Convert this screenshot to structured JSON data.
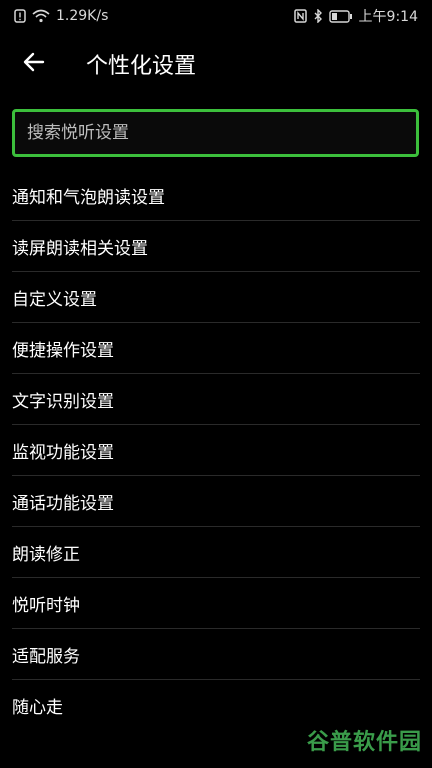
{
  "status_bar": {
    "network_speed": "1.29K/s",
    "time": "上午9:14",
    "icons": [
      "notification-icon",
      "wifi-icon",
      "nfc-icon",
      "bluetooth-icon",
      "battery-icon"
    ]
  },
  "header": {
    "title": "个性化设置"
  },
  "search": {
    "placeholder": "搜索悦听设置"
  },
  "menu": {
    "items": [
      {
        "label": "通知和气泡朗读设置"
      },
      {
        "label": "读屏朗读相关设置"
      },
      {
        "label": "自定义设置"
      },
      {
        "label": "便捷操作设置"
      },
      {
        "label": "文字识别设置"
      },
      {
        "label": "监视功能设置"
      },
      {
        "label": "通话功能设置"
      },
      {
        "label": "朗读修正"
      },
      {
        "label": "悦听时钟"
      },
      {
        "label": "适配服务"
      },
      {
        "label": "随心走"
      }
    ]
  },
  "watermark": {
    "text": "谷普软件园"
  },
  "colors": {
    "background": "#000000",
    "accent_border": "#3cbf3c",
    "divider": "#2a2a2a",
    "watermark": "#3a9c4a"
  }
}
